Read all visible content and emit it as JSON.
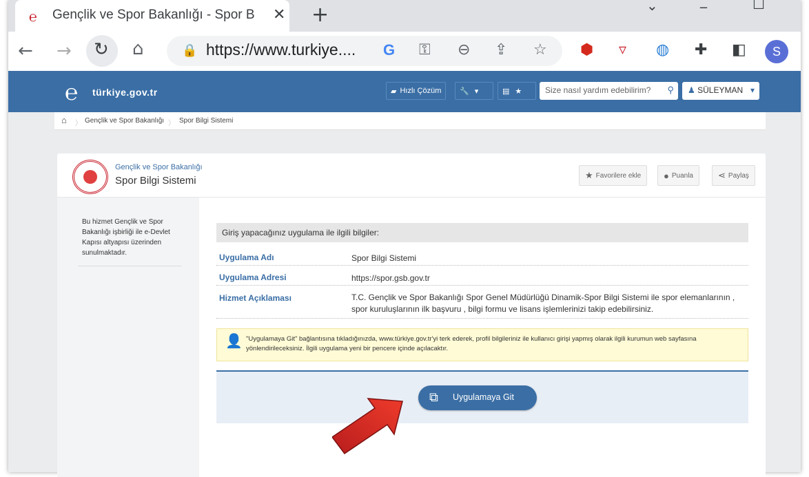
{
  "browser": {
    "tab_title": "Gençlik ve Spor Bakanlığı - Spor B",
    "tab_close": "✕",
    "new_tab": "+",
    "url": "https://www.turkiye....",
    "profile_initial": "S",
    "icons": [
      "back-icon",
      "forward-icon",
      "reload-icon",
      "home-icon",
      "lock-icon",
      "google-icon",
      "key-icon",
      "zoom-out-icon",
      "share-icon",
      "star-icon",
      "stop-extension-icon",
      "shield-extension-icon",
      "globe-extension-icon",
      "puzzle-extension-icon",
      "sidepanel-icon"
    ]
  },
  "header": {
    "logo_text": "türkiye.gov.tr",
    "quick_solution": "Hızlı Çözüm",
    "search_placeholder": "Size nasıl yardım edebilirim?",
    "user_name": "SÜLEYMAN",
    "colors": {
      "bar": "#3a6ea5"
    }
  },
  "breadcrumb": {
    "items": [
      "Gençlik ve Spor Bakanlığı",
      "Spor Bilgi Sistemi"
    ]
  },
  "service": {
    "ministry": "Gençlik ve Spor Bakanlığı",
    "name": "Spor Bilgi Sistemi",
    "actions": {
      "favorite": "Favorilere ekle",
      "rate": "Puanla",
      "share": "Paylaş"
    }
  },
  "sidebar": {
    "text": "Bu hizmet Gençlik ve Spor Bakanlığı işbirliği ile e-Devlet Kapısı altyapısı üzerinden sunulmaktadır."
  },
  "info": {
    "heading": "Giriş yapacağınız uygulama ile ilgili bilgiler:",
    "rows": [
      {
        "label": "Uygulama Adı",
        "value": "Spor Bilgi Sistemi"
      },
      {
        "label": "Uygulama Adresi",
        "value": "https://spor.gsb.gov.tr"
      },
      {
        "label": "Hizmet Açıklaması",
        "value": "T.C. Gençlik ve Spor Bakanlığı Spor Genel Müdürlüğü Dinamik-Spor Bilgi Sistemi ile spor elemanlarının , spor kuruluşlarının ilk başvuru , bilgi formu ve lisans işlemlerinizi takip edebilirsiniz."
      }
    ]
  },
  "notice": {
    "text": "\"Uygulamaya Git\" bağlantısına tıkladığınızda, www.türkiye.gov.tr'yi terk ederek, profil bilgileriniz ile kullanıcı girişi yapmış olarak ilgili kurumun web sayfasına yönlendirileceksiniz. İlgili uygulama yeni bir pencere içinde açılacaktır."
  },
  "go": {
    "label": "Uygulamaya Git"
  }
}
